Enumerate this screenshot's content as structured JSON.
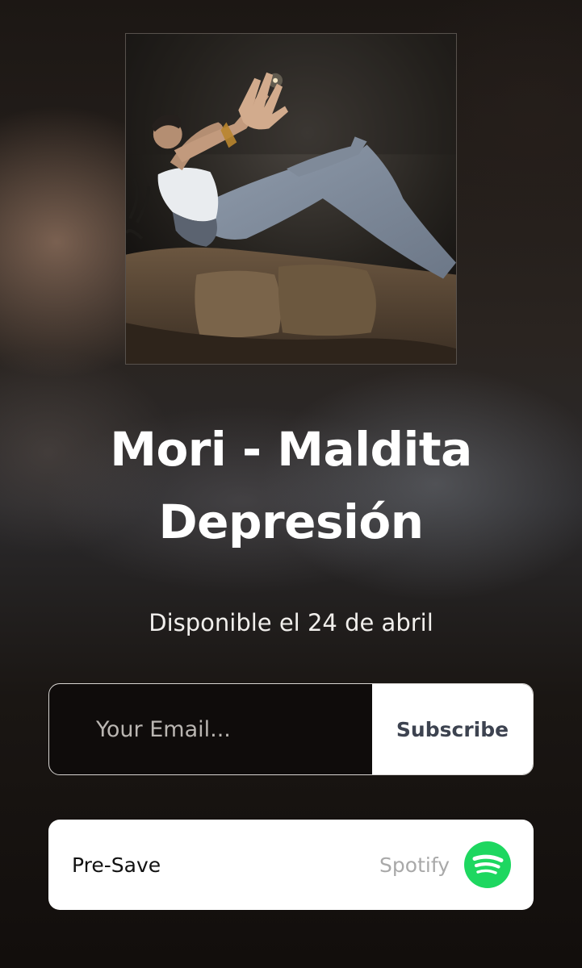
{
  "release": {
    "title_line1": "Mori - Maldita",
    "title_line2": "Depresión",
    "subtitle": "Disponible el 24 de abril"
  },
  "cover": {
    "alt": "album cover"
  },
  "subscribe_form": {
    "email_placeholder": "Your Email...",
    "subscribe_label": "Subscribe"
  },
  "presave": {
    "label": "Pre-Save",
    "service": "Spotify",
    "service_icon": "spotify-icon"
  },
  "colors": {
    "spotify_green": "#1ed760",
    "button_text": "#3d4350",
    "text_primary": "#ffffff"
  }
}
